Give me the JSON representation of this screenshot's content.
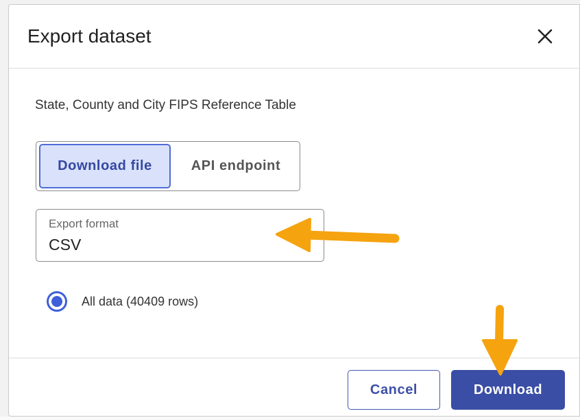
{
  "dialog": {
    "title": "Export dataset",
    "close_icon": "close-icon",
    "dataset_name": "State, County and City FIPS Reference Table",
    "tabs": [
      {
        "label": "Download file",
        "selected": true
      },
      {
        "label": "API endpoint",
        "selected": false
      }
    ],
    "export_format": {
      "label": "Export format",
      "value": "CSV"
    },
    "data_option": {
      "label": "All data (40409 rows)",
      "selected": true
    },
    "buttons": {
      "cancel": "Cancel",
      "download": "Download"
    }
  },
  "annotations": {
    "arrow_color": "#f5a30f",
    "arrow_icon": "arrow-icon"
  },
  "colors": {
    "accent": "#3a4ea6",
    "selected_tab_bg": "#d9e1fb",
    "radio": "#3f5fd8"
  }
}
